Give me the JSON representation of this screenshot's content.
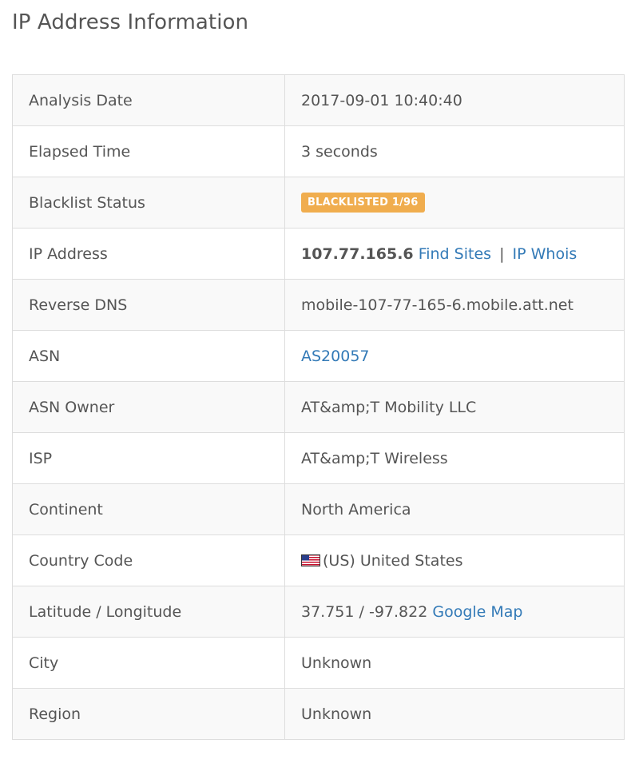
{
  "page": {
    "title": "IP Address Information"
  },
  "rows": {
    "analysis_date": {
      "label": "Analysis Date",
      "value": "2017-09-01 10:40:40"
    },
    "elapsed_time": {
      "label": "Elapsed Time",
      "value": "3 seconds"
    },
    "blacklist_status": {
      "label": "Blacklist Status",
      "badge": "BLACKLISTED 1/96"
    },
    "ip_address": {
      "label": "IP Address",
      "ip": "107.77.165.6",
      "find_sites_link": "Find Sites",
      "separator": "|",
      "ip_whois_link": "IP Whois"
    },
    "reverse_dns": {
      "label": "Reverse DNS",
      "value": "mobile-107-77-165-6.mobile.att.net"
    },
    "asn": {
      "label": "ASN",
      "link": "AS20057"
    },
    "asn_owner": {
      "label": "ASN Owner",
      "value": "AT&amp;T Mobility LLC"
    },
    "isp": {
      "label": "ISP",
      "value": "AT&amp;T Wireless"
    },
    "continent": {
      "label": "Continent",
      "value": "North America"
    },
    "country_code": {
      "label": "Country Code",
      "value": "(US) United States",
      "flag_icon": "us-flag-icon"
    },
    "lat_long": {
      "label": "Latitude / Longitude",
      "value": "37.751 / -97.822",
      "map_link": "Google Map"
    },
    "city": {
      "label": "City",
      "value": "Unknown"
    },
    "region": {
      "label": "Region",
      "value": "Unknown"
    }
  },
  "colors": {
    "text": "#555555",
    "link": "#337ab7",
    "badge_warning": "#f0ad4e",
    "border": "#dddddd",
    "stripe": "#f9f9f9"
  }
}
